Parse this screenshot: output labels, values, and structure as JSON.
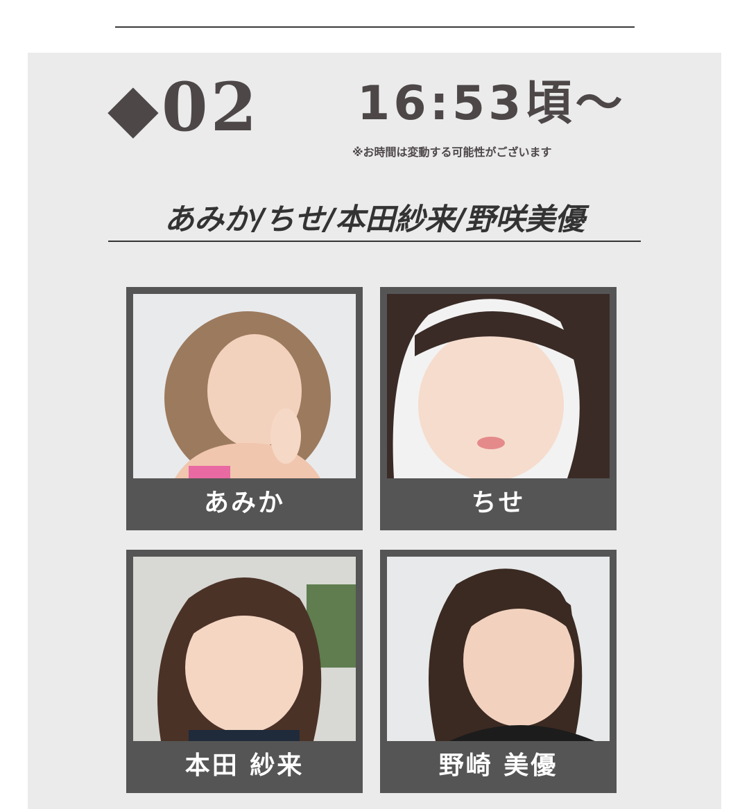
{
  "slot": {
    "number": "◆02",
    "time": "16:53頃〜",
    "note": "※お時間は変動する可能性がございます"
  },
  "lineup": {
    "title": "あみか/ちせ/本田紗来/野咲美優"
  },
  "performers": [
    {
      "name": "あみか",
      "photo_icon": "portrait-photo-icon"
    },
    {
      "name": "ちせ",
      "photo_icon": "portrait-photo-icon"
    },
    {
      "name": "本田 紗来",
      "photo_icon": "portrait-photo-icon"
    },
    {
      "name": "野崎 美優",
      "photo_icon": "portrait-photo-icon"
    }
  ],
  "colors": {
    "panel_bg": "#ebebeb",
    "text_dark": "#4d4748",
    "card_frame": "#555555",
    "name_text": "#ffffff"
  }
}
